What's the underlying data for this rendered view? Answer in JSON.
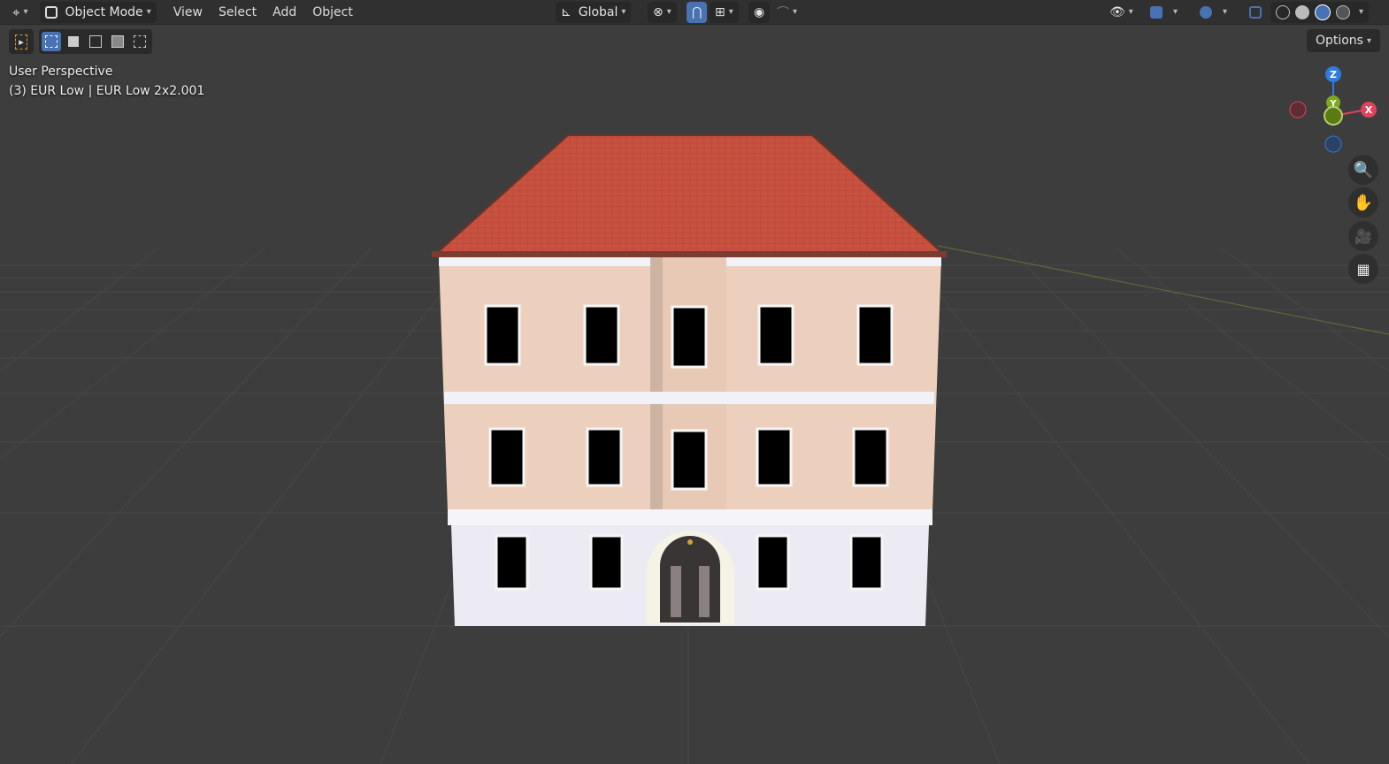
{
  "header": {
    "editor_icon": "editor-type-icon",
    "mode_label": "Object Mode",
    "menus": [
      "View",
      "Select",
      "Add",
      "Object"
    ],
    "orientation_label": "Global"
  },
  "toolbar": {
    "options_label": "Options"
  },
  "viewport": {
    "perspective_label": "User Perspective",
    "object_label": "(3) EUR Low | EUR Low 2x2.001"
  },
  "gizmo": {
    "z_label": "Z",
    "y_label": "Y",
    "x_label": "X",
    "colors": {
      "x": "#e0435b",
      "y": "#7ea81d",
      "z": "#2f7be0"
    }
  },
  "colors": {
    "background": "#3d3d3d",
    "header": "#303030",
    "accent": "#4772b3",
    "roof": "#c8523f",
    "wall_upper": "#ecd0bd",
    "wall_lower": "#ecebf4"
  }
}
